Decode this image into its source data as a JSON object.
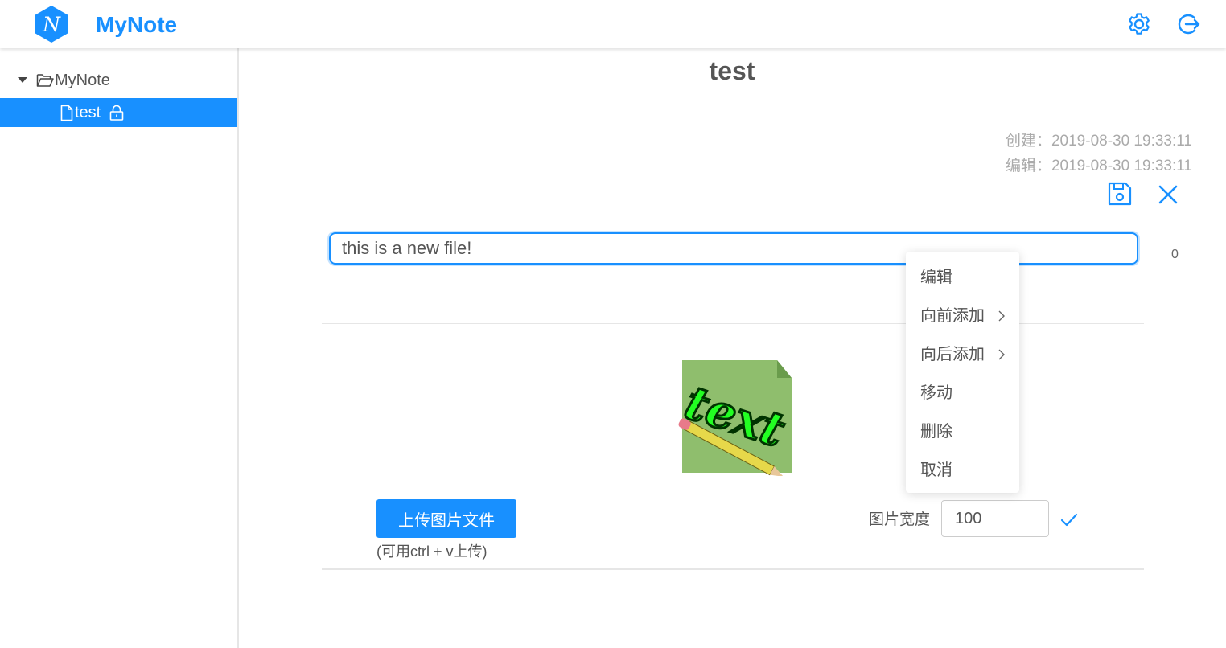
{
  "app": {
    "title": "MyNote",
    "logo_letter": "N",
    "brand_color": "#1890ff"
  },
  "header": {
    "settings_icon": "gear-icon",
    "logout_icon": "logout-icon"
  },
  "sidebar": {
    "tree": {
      "root_label": "MyNote",
      "root_icon": "folder-open-icon",
      "children": [
        {
          "label": "test",
          "icon": "file-icon",
          "locked": true,
          "selected": true
        }
      ]
    }
  },
  "note": {
    "title": "test",
    "created": "创建：2019-08-30 19:33:11",
    "edited": "编辑：2019-08-30 19:33:11",
    "content": "this is a new file!",
    "char_count": "0"
  },
  "upload": {
    "button_label": "上传图片文件",
    "hint": "(可用ctrl + v上传)",
    "width_label": "图片宽度",
    "width_value": "100"
  },
  "context_menu": {
    "items": [
      {
        "label": "编辑",
        "has_submenu": false
      },
      {
        "label": "向前添加",
        "has_submenu": true
      },
      {
        "label": "向后添加",
        "has_submenu": true
      },
      {
        "label": "移动",
        "has_submenu": false
      },
      {
        "label": "删除",
        "has_submenu": false
      },
      {
        "label": "取消",
        "has_submenu": false
      }
    ]
  },
  "image": {
    "icon": "text-pencil-image",
    "text": "text"
  }
}
